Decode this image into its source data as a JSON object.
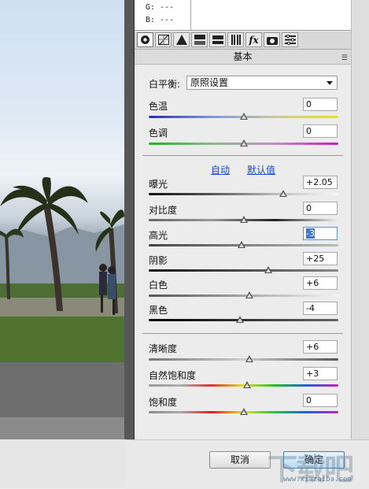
{
  "rgb": {
    "g": "G:  ---",
    "b": "B:  ---"
  },
  "toolbar_icons": [
    "aperture-icon",
    "tone-curve-icon",
    "detail-icon",
    "hsl-icon",
    "split-toning-icon",
    "lens-icon",
    "fx-icon",
    "camera-calibration-icon",
    "presets-icon"
  ],
  "section": {
    "title": "基本"
  },
  "white_balance": {
    "label": "白平衡:",
    "value": "原照设置"
  },
  "temp": {
    "label": "色温",
    "value": "0",
    "level": 0.5
  },
  "tint": {
    "label": "色调",
    "value": "0",
    "level": 0.5
  },
  "auto_label": "自动",
  "default_label": "默认值",
  "exposure": {
    "label": "曝光",
    "value": "+2.05",
    "level": 0.71
  },
  "contrast": {
    "label": "对比度",
    "value": "0",
    "level": 0.5
  },
  "highlights": {
    "label": "高光",
    "value": "-3",
    "level": 0.49
  },
  "shadows": {
    "label": "阴影",
    "value": "+25",
    "level": 0.63
  },
  "whites": {
    "label": "白色",
    "value": "+6",
    "level": 0.53
  },
  "blacks": {
    "label": "黑色",
    "value": "-4",
    "level": 0.48
  },
  "clarity": {
    "label": "清晰度",
    "value": "+6",
    "level": 0.53
  },
  "vibrance": {
    "label": "自然饱和度",
    "value": "+3",
    "level": 0.52
  },
  "saturation": {
    "label": "饱和度",
    "value": "0",
    "level": 0.5
  },
  "buttons": {
    "cancel": "取消",
    "ok": "确定"
  },
  "watermark": {
    "text": "下载吧",
    "url": "www.xiazaiba.com"
  }
}
